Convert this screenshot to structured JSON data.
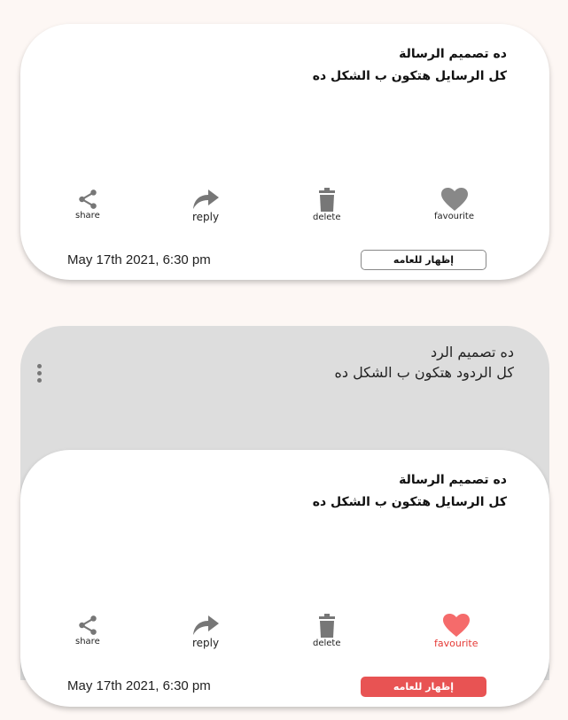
{
  "message_card": {
    "line1": "ده تصميم الرسالة",
    "line2": "كل الرسايل هتكون ب الشكل ده",
    "actions": {
      "share": "share",
      "reply": "reply",
      "delete": "delete",
      "favourite": "favourite"
    },
    "date": "May 17th 2021, 6:30 pm",
    "publish_label": "إظهار للعامه",
    "favourited": false
  },
  "reply_card": {
    "line1": "ده تصميم الرد",
    "line2": "كل الردود هتكون ب الشكل ده"
  },
  "message_card_2": {
    "line1": "ده تصميم الرسالة",
    "line2": "كل الرسايل هتكون ب الشكل ده",
    "actions": {
      "share": "share",
      "reply": "reply",
      "delete": "delete",
      "favourite": "favourite"
    },
    "date": "May 17th 2021, 6:30 pm",
    "publish_label": "إظهار للعامه",
    "favourited": true
  },
  "colors": {
    "accent_red": "#e85353",
    "icon_gray": "#777777",
    "reply_bg": "#dddddd"
  }
}
